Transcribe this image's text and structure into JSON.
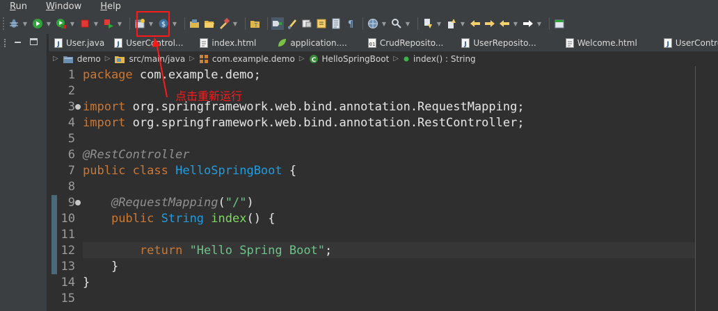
{
  "menu": {
    "items": [
      {
        "mnemonic": "R",
        "rest": "un"
      },
      {
        "mnemonic": "W",
        "rest": "indow"
      },
      {
        "mnemonic": "H",
        "rest": "elp"
      }
    ]
  },
  "toolbar": {
    "buttons": [
      "debug-icon",
      "run-icon",
      "run-coverage-icon",
      "terminate-icon",
      "relaunch-icon",
      "new-server-icon",
      "spring-icon",
      "open-project-icon",
      "open-folder-icon",
      "build-icon",
      "open-type-icon",
      "toggle-breadcrumb-icon",
      "mark-occurrences-icon",
      "toggle-block-selection-icon",
      "show-whitespace-icon",
      "globe-icon",
      "search-icon",
      "next-annotation-icon",
      "previous-edit-icon",
      "back-icon",
      "forward-icon",
      "pin-editor-icon"
    ]
  },
  "annotation": {
    "text": "点击重新运行",
    "color": "#ff1a1a"
  },
  "tabs": [
    {
      "label": "User.java",
      "icon": "java-file-icon"
    },
    {
      "label": "UserControl...",
      "icon": "java-file-icon"
    },
    {
      "label": "index.html",
      "icon": "html-file-icon"
    },
    {
      "label": "application....",
      "icon": "spring-properties-icon"
    },
    {
      "label": "CrudReposito...",
      "icon": "class-file-icon"
    },
    {
      "label": "UserReposito...",
      "icon": "java-file-icon"
    },
    {
      "label": "Welcome.html",
      "icon": "html-file-icon"
    },
    {
      "label": "UserContro...",
      "icon": "java-file-icon"
    }
  ],
  "breadcrumb": {
    "items": [
      {
        "label": "demo",
        "icon": "project-icon"
      },
      {
        "label": "src/main/java",
        "icon": "source-folder-icon"
      },
      {
        "label": "com.example.demo",
        "icon": "package-icon"
      },
      {
        "label": "HelloSpringBoot",
        "icon": "class-icon"
      },
      {
        "label": "index() : String",
        "icon": "method-icon"
      }
    ]
  },
  "editor": {
    "current_line": 12,
    "line_numbers": [
      "1",
      "2",
      "3",
      "4",
      "5",
      "6",
      "7",
      "8",
      "9",
      "10",
      "11",
      "12",
      "13",
      "14",
      "15"
    ],
    "code_lines": [
      "package com.example.demo;",
      "",
      "import org.springframework.web.bind.annotation.RequestMapping;",
      "import org.springframework.web.bind.annotation.RestController;",
      "",
      "@RestController",
      "public class HelloSpringBoot {",
      "",
      "    @RequestMapping(\"/\")",
      "    public String index() {",
      "",
      "        return \"Hello Spring Boot\";",
      "    }",
      "}",
      ""
    ],
    "tokens": {
      "l1_kw": "package",
      "l1_rest": " com.example.demo;",
      "l3_kw": "import",
      "l3_rest": " org.springframework.web.bind.annotation.RequestMapping;",
      "l4_kw": "import",
      "l4_rest": " org.springframework.web.bind.annotation.RestController;",
      "l6_ann": "@RestController",
      "l7_kw1": "public",
      "l7_kw2": "class",
      "l7_cls": "HelloSpringBoot",
      "l7_rest": " {",
      "l9_ann": "@RequestMapping",
      "l9_p1": "(",
      "l9_str": "\"/\"",
      "l9_p2": ")",
      "l10_kw": "public",
      "l10_cls": "String",
      "l10_fn": "index",
      "l10_rest": "() {",
      "l12_kw": "return",
      "l12_str": "\"Hello Spring Boot\"",
      "l12_rest": ";",
      "l13": "}",
      "l14": "}"
    }
  }
}
